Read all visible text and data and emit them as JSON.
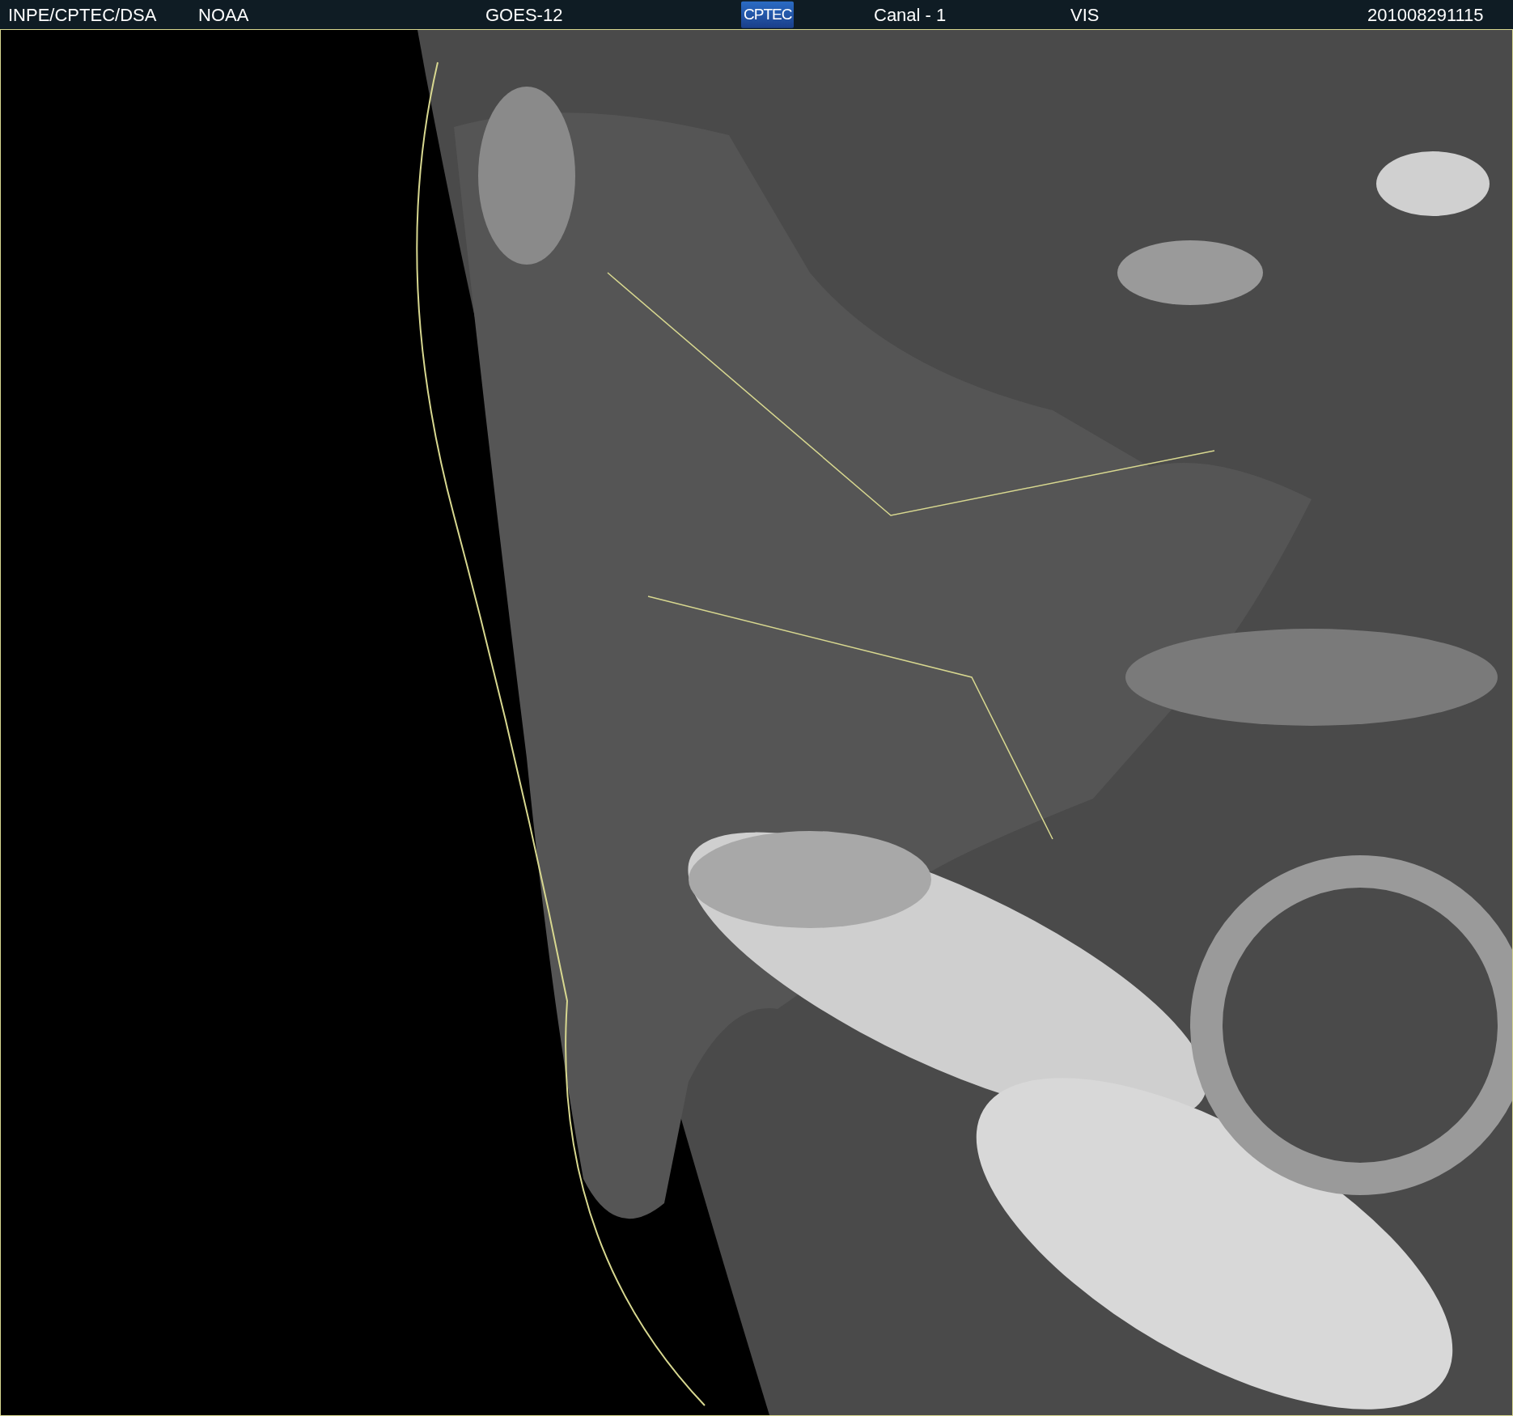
{
  "header": {
    "items": [
      {
        "kind": "text",
        "text": "INPE/CPTEC/DSA"
      },
      {
        "kind": "text",
        "text": "NOAA"
      },
      {
        "kind": "text",
        "text": "GOES-12"
      },
      {
        "kind": "logo",
        "text": "CPTEC"
      },
      {
        "kind": "text",
        "text": "Canal - 1"
      },
      {
        "kind": "text",
        "text": "VIS"
      },
      {
        "kind": "text",
        "text": "201008291115"
      }
    ]
  }
}
